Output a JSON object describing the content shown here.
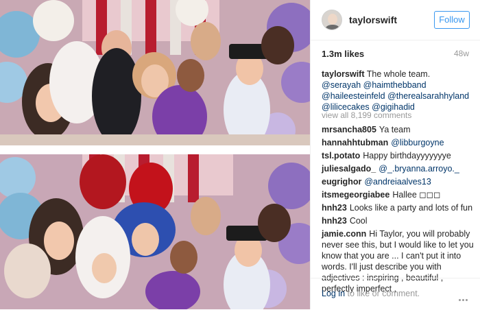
{
  "post": {
    "username": "taylorswift",
    "follow_label": "Follow",
    "likes": "1.3m likes",
    "age": "48w",
    "caption_user": "taylorswift",
    "caption_text": "The whole team.",
    "caption_tags": [
      "@serayah",
      "@haimthebband",
      "@haileesteinfeld",
      "@therealsarahhyland",
      "@lilicecakes",
      "@gigihadid"
    ],
    "view_all": "view all 8,199 comments",
    "login_link": "Log in",
    "login_text": "to like or comment."
  },
  "comments": [
    {
      "user": "mrsancha805",
      "text": "Ya team"
    },
    {
      "user": "hannahhtubman",
      "text": "@libburgoyne"
    },
    {
      "user": "tsl.potato",
      "text": "Happy birthdayyyyyyye"
    },
    {
      "user": "juliesalgado_",
      "text": "@_.bryanna.arroyo._"
    },
    {
      "user": "eugrighor",
      "text": "@andreiaalves13"
    },
    {
      "user": "itsmegeorgiabee",
      "text": "Hallee ◻◻◻"
    },
    {
      "user": "hnh23",
      "text": "Looks like a party and lots of fun"
    },
    {
      "user": "hnh23",
      "text": "Cool"
    },
    {
      "user": "jamie.conn",
      "text": "Hi Taylor, you will probably never see this, but I would like to let you know that you are ... I can't put it into words. I'll just describe you with adjectives : inspiring , beautiful , perfectly imperfect ,"
    }
  ],
  "colors": {
    "follow_blue": "#3897f0",
    "link_blue": "#003569",
    "muted": "#999999",
    "text": "#262626"
  }
}
